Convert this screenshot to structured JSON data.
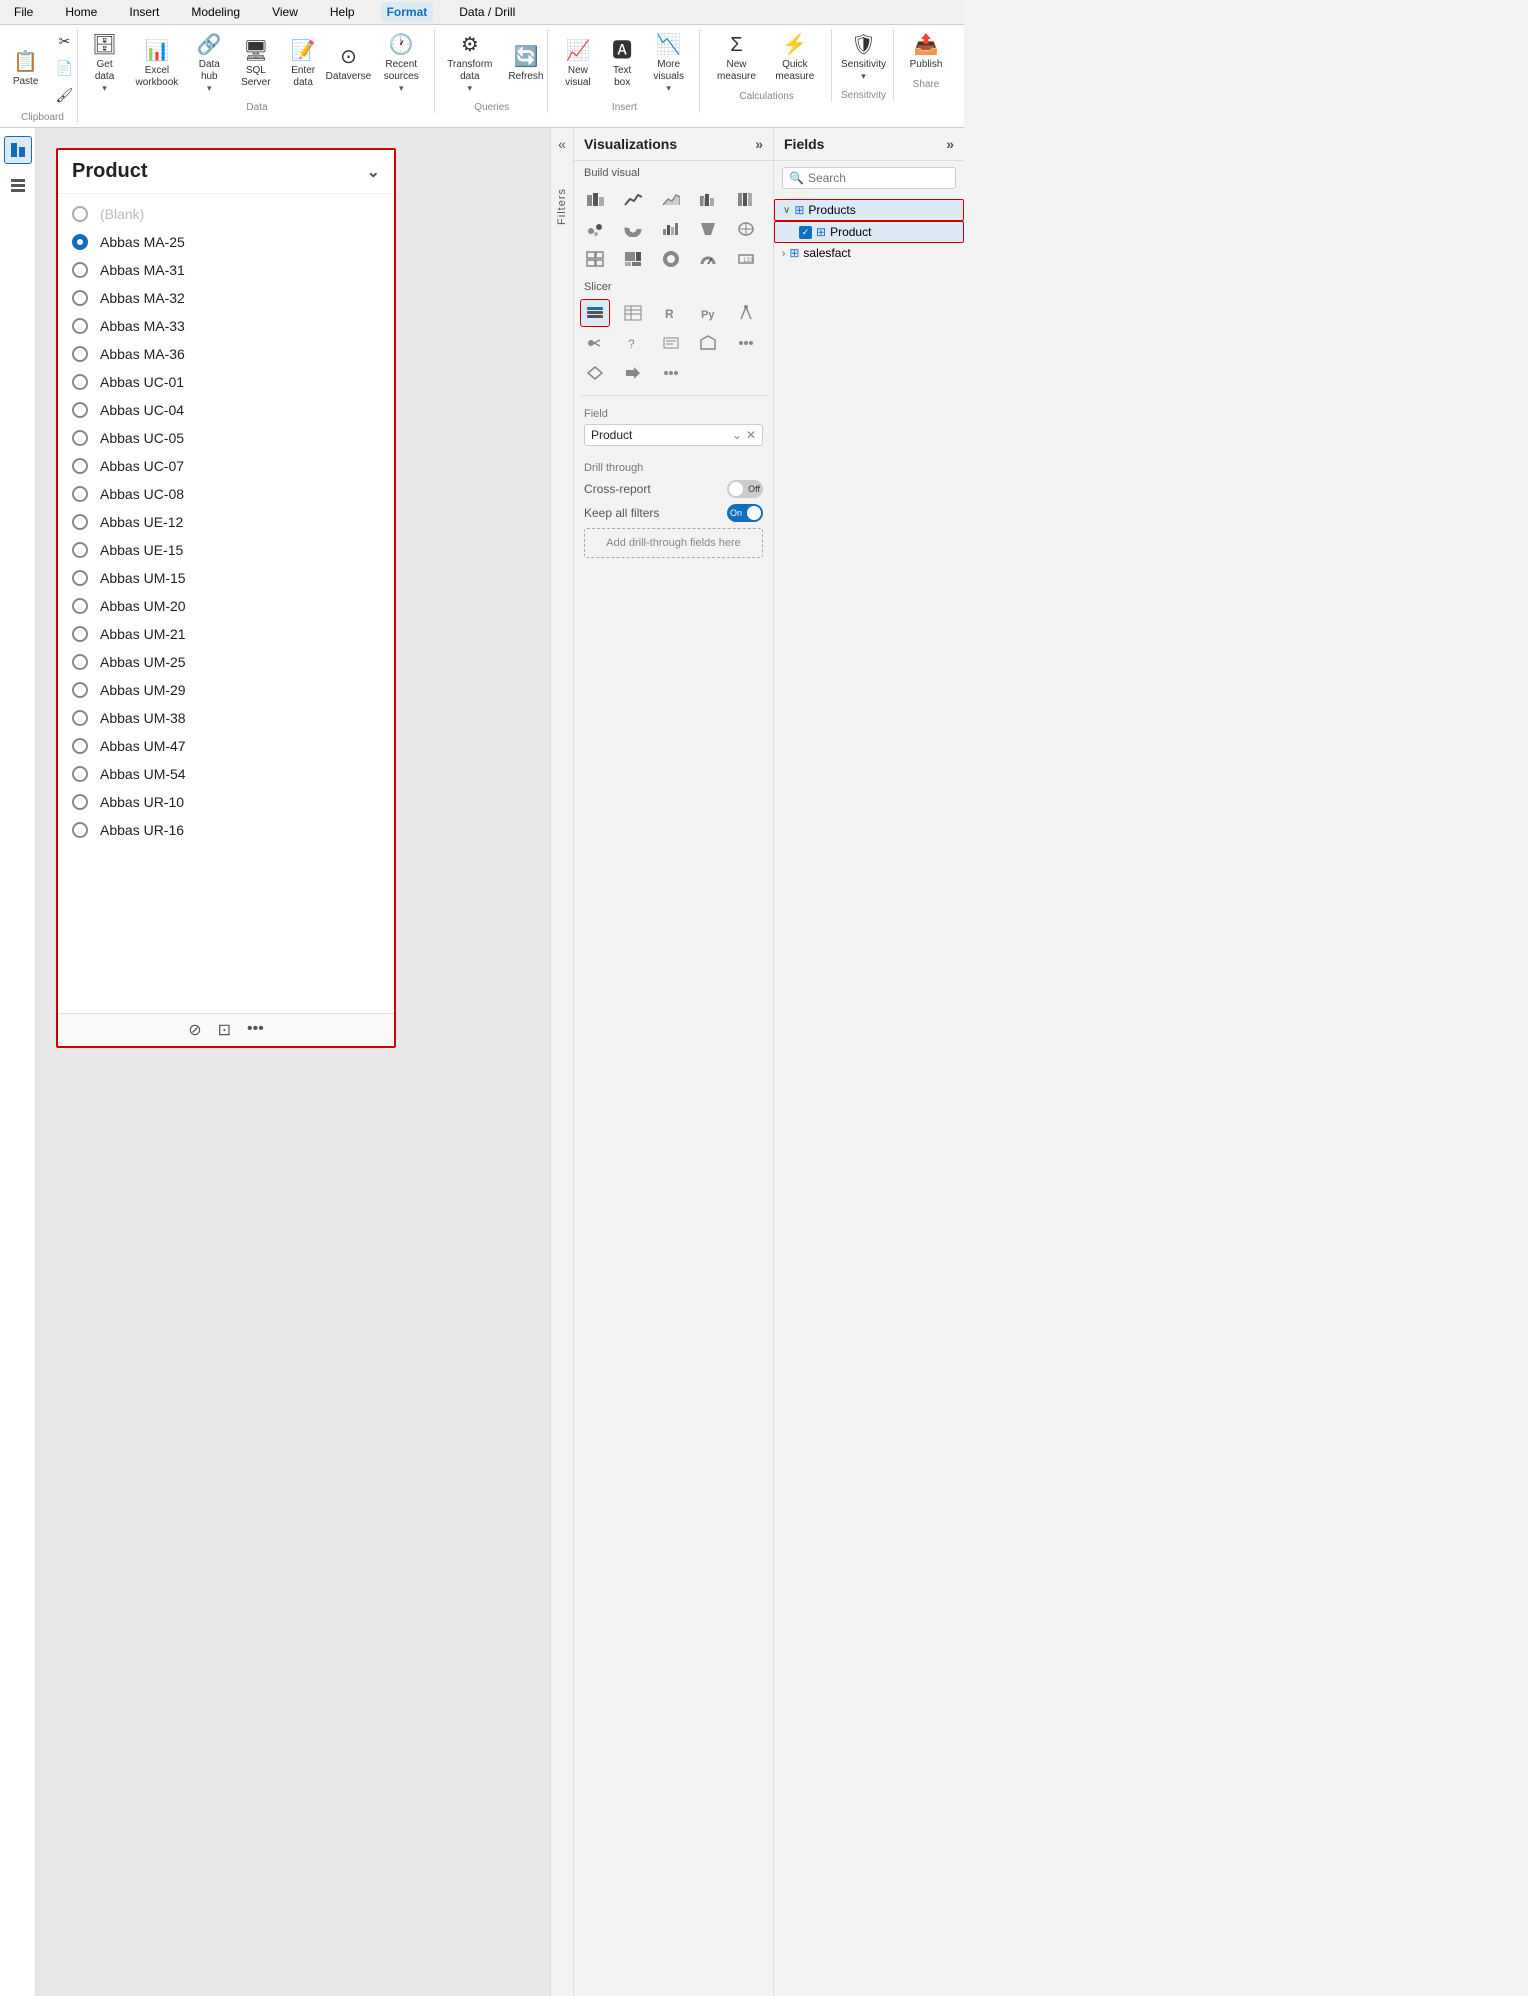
{
  "menubar": {
    "items": [
      "File",
      "Home",
      "Insert",
      "Modeling",
      "View",
      "Help",
      "Format",
      "Data / Drill"
    ]
  },
  "ribbon": {
    "clipboard_label": "Clipboard",
    "data_label": "Data",
    "queries_label": "Queries",
    "insert_label": "Insert",
    "calculations_label": "Calculations",
    "sensitivity_label": "Sensitivity",
    "share_label": "Share",
    "paste_label": "Paste",
    "get_data_label": "Get data",
    "excel_label": "Excel workbook",
    "data_hub_label": "Data hub",
    "sql_label": "SQL Server",
    "enter_data_label": "Enter data",
    "dataverse_label": "Dataverse",
    "recent_sources_label": "Recent sources",
    "transform_label": "Transform data",
    "refresh_label": "Refresh",
    "new_visual_label": "New visual",
    "text_box_label": "Text box",
    "more_visuals_label": "More visuals",
    "new_measure_label": "New measure",
    "quick_measure_label": "Quick measure",
    "sensitivity_btn_label": "Sensitivity",
    "publish_label": "Publish"
  },
  "slicer": {
    "title": "Product",
    "items": [
      {
        "label": "(Blank)",
        "selected": false,
        "blank": true
      },
      {
        "label": "Abbas MA-25",
        "selected": true
      },
      {
        "label": "Abbas MA-31",
        "selected": false
      },
      {
        "label": "Abbas MA-32",
        "selected": false
      },
      {
        "label": "Abbas MA-33",
        "selected": false
      },
      {
        "label": "Abbas MA-36",
        "selected": false
      },
      {
        "label": "Abbas UC-01",
        "selected": false
      },
      {
        "label": "Abbas UC-04",
        "selected": false
      },
      {
        "label": "Abbas UC-05",
        "selected": false
      },
      {
        "label": "Abbas UC-07",
        "selected": false
      },
      {
        "label": "Abbas UC-08",
        "selected": false
      },
      {
        "label": "Abbas UE-12",
        "selected": false
      },
      {
        "label": "Abbas UE-15",
        "selected": false
      },
      {
        "label": "Abbas UM-15",
        "selected": false
      },
      {
        "label": "Abbas UM-20",
        "selected": false
      },
      {
        "label": "Abbas UM-21",
        "selected": false
      },
      {
        "label": "Abbas UM-25",
        "selected": false
      },
      {
        "label": "Abbas UM-29",
        "selected": false
      },
      {
        "label": "Abbas UM-38",
        "selected": false
      },
      {
        "label": "Abbas UM-47",
        "selected": false
      },
      {
        "label": "Abbas UM-54",
        "selected": false
      },
      {
        "label": "Abbas UR-10",
        "selected": false
      },
      {
        "label": "Abbas UR-16",
        "selected": false
      }
    ],
    "footer_icons": [
      "filter",
      "expand",
      "more"
    ]
  },
  "filters": {
    "label": "Filters",
    "arrow": "«"
  },
  "visualizations": {
    "title": "Visualizations",
    "expand_icon": "»",
    "build_visual_label": "Build visual",
    "slicer_label": "Slicer",
    "field_label": "Field",
    "field_value": "Product",
    "drill_through_label": "Drill through",
    "cross_report_label": "Cross-report",
    "cross_report_state": "Off",
    "keep_filters_label": "Keep all filters",
    "keep_filters_state": "On",
    "add_drill_label": "Add drill-through fields here"
  },
  "fields": {
    "title": "Fields",
    "expand_icon": "»",
    "search_placeholder": "Search",
    "tree": [
      {
        "label": "Products",
        "expanded": true,
        "highlighted": true,
        "children": [
          {
            "label": "Product",
            "checked": true,
            "highlighted": true
          }
        ]
      },
      {
        "label": "salesfact",
        "expanded": false,
        "highlighted": false,
        "children": []
      }
    ]
  }
}
